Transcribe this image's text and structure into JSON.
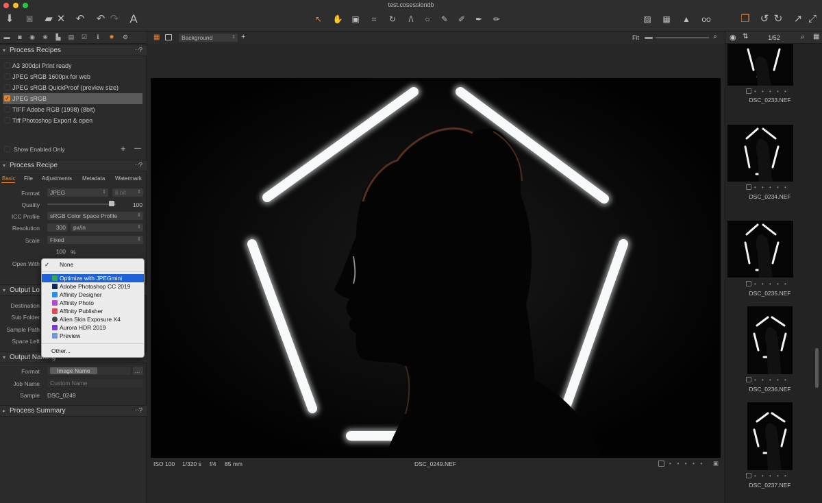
{
  "window": {
    "title": "test.cosessiondb"
  },
  "toolbar": {
    "icons": [
      "download-icon",
      "camera-icon",
      "folder-remove-icon",
      "undo-hand-icon",
      "undo-icon",
      "redo-icon",
      "text-tool-icon",
      "pointer-icon",
      "pan-icon",
      "loupe-icon",
      "crop-icon",
      "rotate-icon",
      "keystone-icon",
      "circle-mask-icon",
      "brush-icon",
      "eraser-icon",
      "picker-icon",
      "annotation-icon",
      "color-editor-icon",
      "grid-icon",
      "warning-icon",
      "glasses-icon",
      "stack-icon",
      "rotate-left-icon",
      "rotate-right-icon",
      "share-icon",
      "expand-icon"
    ]
  },
  "left": {
    "process_recipes": {
      "title": "Process Recipes",
      "help": "?",
      "more": "···",
      "items": [
        {
          "label": "A3 300dpi Print ready",
          "selected": false
        },
        {
          "label": "JPEG sRGB 1600px for web",
          "selected": false
        },
        {
          "label": "JPEG sRGB QuickProof (preview size)",
          "selected": false
        },
        {
          "label": "JPEG sRGB",
          "selected": true
        },
        {
          "label": "TIFF Adobe RGB (1998) (8bit)",
          "selected": false
        },
        {
          "label": "Tiff Photoshop Export & open",
          "selected": false
        }
      ],
      "show_enabled_only": "Show Enabled Only",
      "add": "+",
      "remove": "—"
    },
    "process_recipe": {
      "title": "Process Recipe",
      "tabs": [
        "Basic",
        "File",
        "Adjustments",
        "Metadata",
        "Watermark"
      ],
      "active_tab": "Basic",
      "format_label": "Format",
      "format_value": "JPEG",
      "bitdepth_value": "8 bit",
      "quality_label": "Quality",
      "quality_value": "100",
      "quality_fraction": 1.0,
      "icc_label": "ICC Profile",
      "icc_value": "sRGB Color Space Profile",
      "resolution_label": "Resolution",
      "resolution_value": "300",
      "resolution_unit": "px/in",
      "scale_label": "Scale",
      "scale_value": "Fixed",
      "scale_percent": "100",
      "percent_sign": "%",
      "open_with_label": "Open With"
    },
    "output_location": {
      "title": "Output Lo",
      "labels": [
        "Destination",
        "Sub Folder",
        "Sample Path",
        "Space Left"
      ]
    },
    "output_naming": {
      "title": "Output Naming",
      "format_label": "Format",
      "format_token": "Image Name",
      "format_more": "...",
      "job_name_label": "Job Name",
      "job_name_placeholder": "Custom Name",
      "sample_label": "Sample",
      "sample_value": "DSC_0249"
    },
    "process_summary": {
      "title": "Process Summary"
    }
  },
  "dropdown": {
    "items": [
      {
        "label": "None",
        "checked": true,
        "icon": ""
      },
      {
        "label": "Optimize with JPEGmini",
        "highlighted": true,
        "icon": "jpegmini-icon",
        "color": "#35a852"
      },
      {
        "label": "Adobe Photoshop CC 2019",
        "icon": "photoshop-icon",
        "color": "#0c2a5a"
      },
      {
        "label": "Affinity Designer",
        "icon": "affinity-designer-icon",
        "color": "#2b8ee8"
      },
      {
        "label": "Affinity Photo",
        "icon": "affinity-photo-icon",
        "color": "#b14bd6"
      },
      {
        "label": "Affinity Publisher",
        "icon": "affinity-publisher-icon",
        "color": "#e2485a"
      },
      {
        "label": "Alien Skin Exposure X4",
        "icon": "exposure-icon",
        "color": "#444444"
      },
      {
        "label": "Aurora HDR 2019",
        "icon": "aurora-icon",
        "color": "#7a3fd0"
      },
      {
        "label": "Preview",
        "icon": "preview-icon",
        "color": "#6d9ad6"
      }
    ],
    "other": "Other..."
  },
  "viewer": {
    "layer": "Background",
    "fit": "Fit",
    "iso": "ISO 100",
    "shutter": "1/320 s",
    "aperture": "f/4",
    "focal": "85 mm",
    "filename": "DSC_0249.NEF",
    "rating_dots": "• • • • •"
  },
  "browser": {
    "count": "1/52",
    "thumbs": [
      {
        "name": "DSC_0233.NEF"
      },
      {
        "name": "DSC_0234.NEF"
      },
      {
        "name": "DSC_0235.NEF"
      },
      {
        "name": "DSC_0236.NEF"
      },
      {
        "name": "DSC_0237.NEF"
      }
    ],
    "rating_dots": "• • • • •"
  }
}
